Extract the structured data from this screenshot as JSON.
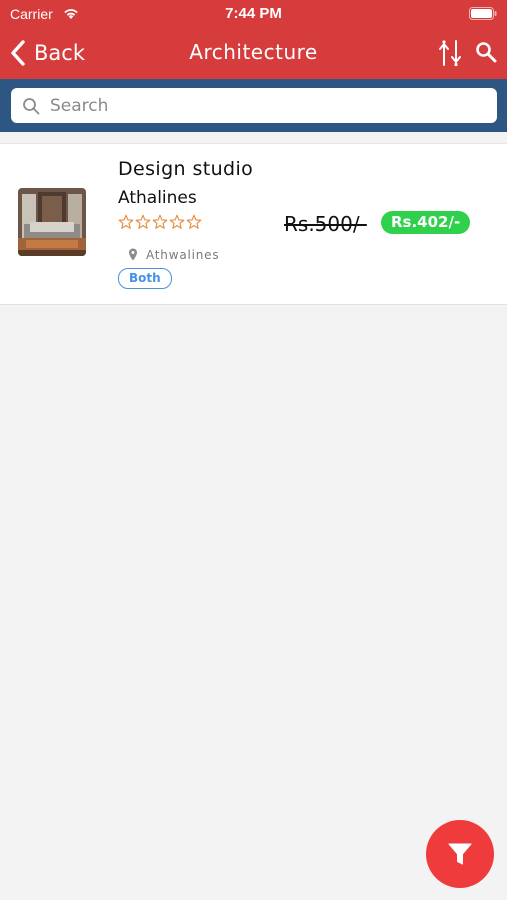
{
  "status_bar": {
    "carrier": "Carrier",
    "time": "7:44 PM"
  },
  "navbar": {
    "back_label": "Back",
    "title": "Architecture"
  },
  "search": {
    "placeholder": "Search",
    "value": ""
  },
  "listing": {
    "title": "Design studio",
    "subtitle": "Athalines",
    "rating": 0,
    "rating_max": 5,
    "old_price": "Rs.500/-",
    "new_price": "Rs.402/-",
    "location": "Athwalines",
    "badge": "Both"
  },
  "colors": {
    "header": "#d63c3c",
    "search_bar": "#2d5782",
    "price_badge": "#2fd04b",
    "badge_outline": "#4a90e2",
    "fab": "#ef3b3b",
    "stars": "#e58a3a"
  },
  "icons": [
    "wifi-icon",
    "battery-icon",
    "chevron-left-icon",
    "sort-arrows-icon",
    "search-icon",
    "star-outline-icon",
    "location-pin-icon",
    "filter-icon"
  ]
}
